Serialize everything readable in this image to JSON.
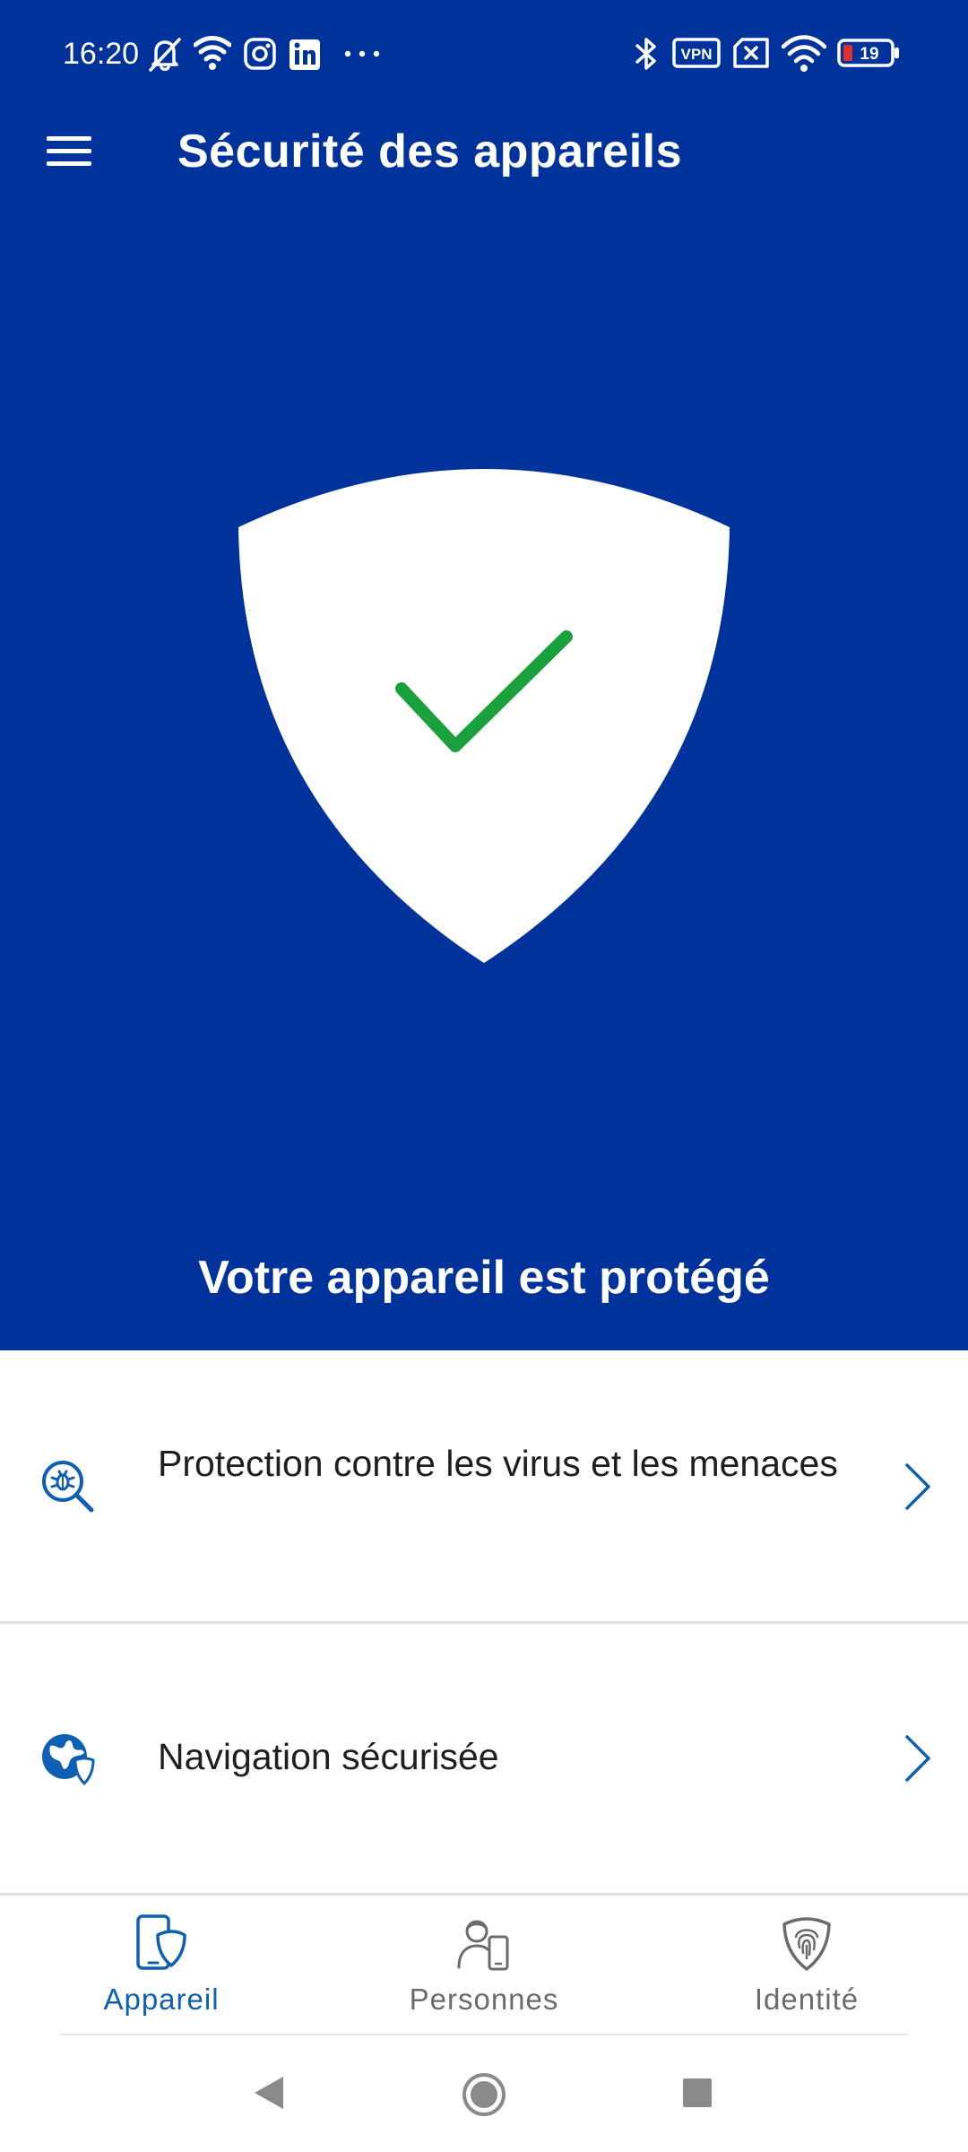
{
  "status_bar": {
    "time": "16:20",
    "icons": [
      "mute-bell-icon",
      "wifi-signal-icon",
      "instagram-icon",
      "linkedin-icon",
      "more-dots-icon",
      "bluetooth-icon",
      "vpn-icon",
      "no-sim-icon",
      "wifi-icon",
      "battery-icon"
    ],
    "vpn_label": "VPN",
    "battery_level": "19",
    "battery_fraction": 0.19
  },
  "app_bar": {
    "menu_icon": "hamburger-menu-icon",
    "title": "Sécurité des appareils"
  },
  "hero": {
    "illustration": "shield-check-icon",
    "status_text": "Votre appareil est protégé"
  },
  "list": {
    "items": [
      {
        "label": "Protection contre les virus et les menaces",
        "icon": "virus-scan-icon"
      },
      {
        "label": "Navigation sécurisée",
        "icon": "globe-shield-icon"
      }
    ]
  },
  "bottom_nav": {
    "tabs": [
      {
        "label": "Appareil",
        "icon": "device-shield-icon",
        "active": true
      },
      {
        "label": "Personnes",
        "icon": "person-device-icon",
        "active": false
      },
      {
        "label": "Identité",
        "icon": "fingerprint-shield-icon",
        "active": false
      }
    ]
  },
  "system_nav": {
    "buttons": [
      "back-triangle-icon",
      "home-circle-icon",
      "recents-square-icon"
    ]
  },
  "colors": {
    "hero_background": "#00329b",
    "accent_blue": "#0f5fb4",
    "check_green": "#1aa03c",
    "inactive_gray": "#6b6b6b"
  }
}
